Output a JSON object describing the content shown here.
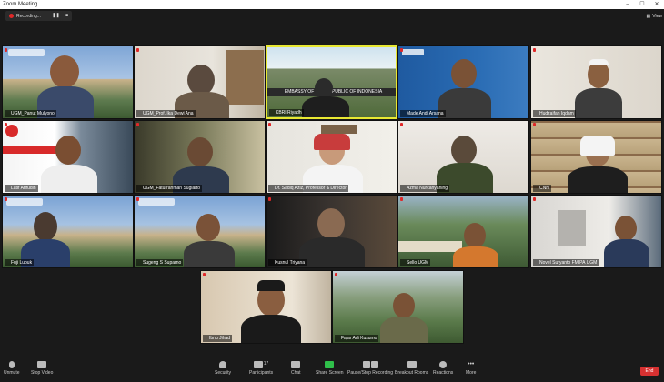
{
  "window": {
    "title": "Zoom Meeting"
  },
  "recording": {
    "label": "Recording..."
  },
  "view_button": {
    "label": "View"
  },
  "participants": [
    {
      "name": "UGM_Panut Mulyono",
      "active": false,
      "muted": true
    },
    {
      "name": "UGM_Prof. Ika Dewi Ana",
      "active": false,
      "muted": true
    },
    {
      "name": "KBRI Riyadh",
      "active": true,
      "muted": false,
      "banner": "EMBASSY OF THE REPUBLIC OF INDONESIA"
    },
    {
      "name": "Made Andi Arsana",
      "active": false,
      "muted": true
    },
    {
      "name": "Hudzaifah Iqdam",
      "active": false,
      "muted": true
    },
    {
      "name": "Latif Arifudin",
      "active": false,
      "muted": true
    },
    {
      "name": "UGM_Faturrahman Sugiarto",
      "active": false,
      "muted": true
    },
    {
      "name": "Dr. Sadiq Aziz, Professor & Director",
      "active": false,
      "muted": true
    },
    {
      "name": "Azma Nurcahyaning",
      "active": false,
      "muted": true
    },
    {
      "name": "CNN",
      "active": false,
      "muted": true
    },
    {
      "name": "Fuji Lubuk",
      "active": false,
      "muted": true
    },
    {
      "name": "Sugeng S Suparno",
      "active": false,
      "muted": true
    },
    {
      "name": "Kusnul Triyana",
      "active": false,
      "muted": true
    },
    {
      "name": "Sello UGM",
      "active": false,
      "muted": true
    },
    {
      "name": "Novel Suryanto FMIPA UGM",
      "active": false,
      "muted": true
    },
    {
      "name": "Ibnu Jihad",
      "active": false,
      "muted": true
    },
    {
      "name": "Fajar Adi Kusumo",
      "active": false,
      "muted": true
    }
  ],
  "toolbar": {
    "unmute": "Unmute",
    "stop_video": "Stop Video",
    "security": "Security",
    "participants": "Participants",
    "participants_count": "17",
    "chat": "Chat",
    "share_screen": "Share Screen",
    "pause_recording": "Pause/Stop Recording",
    "breakout_rooms": "Breakout Rooms",
    "reactions": "Reactions",
    "more": "More",
    "end": "End"
  },
  "colors": {
    "active_speaker": "#e8e832",
    "end_button": "#d73131",
    "share_green": "#2fbf4a"
  }
}
